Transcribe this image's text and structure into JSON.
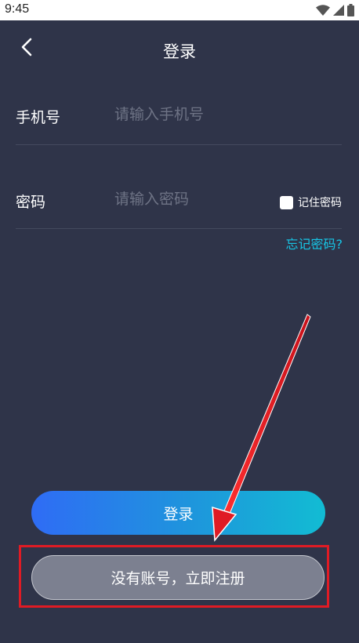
{
  "status_bar": {
    "time": "9:45",
    "icons": [
      "wifi-icon",
      "signal-icon",
      "battery-icon"
    ]
  },
  "header": {
    "title": "登录",
    "back_icon": "back-chevron-icon"
  },
  "form": {
    "phone": {
      "label": "手机号",
      "placeholder": "请输入手机号",
      "value": ""
    },
    "password": {
      "label": "密码",
      "placeholder": "请输入密码",
      "value": ""
    },
    "remember_label": "记住密码",
    "remember_checked": false,
    "forgot_link": "忘记密码?"
  },
  "actions": {
    "login_label": "登录",
    "register_label": "没有账号，立即注册"
  },
  "colors": {
    "background": "#2f3449",
    "accent_link": "#17c6e6",
    "login_gradient_start": "#2f6cf5",
    "login_gradient_end": "#12bcd3",
    "register_button": "#7c8090",
    "annotation_red": "#e01b24"
  }
}
